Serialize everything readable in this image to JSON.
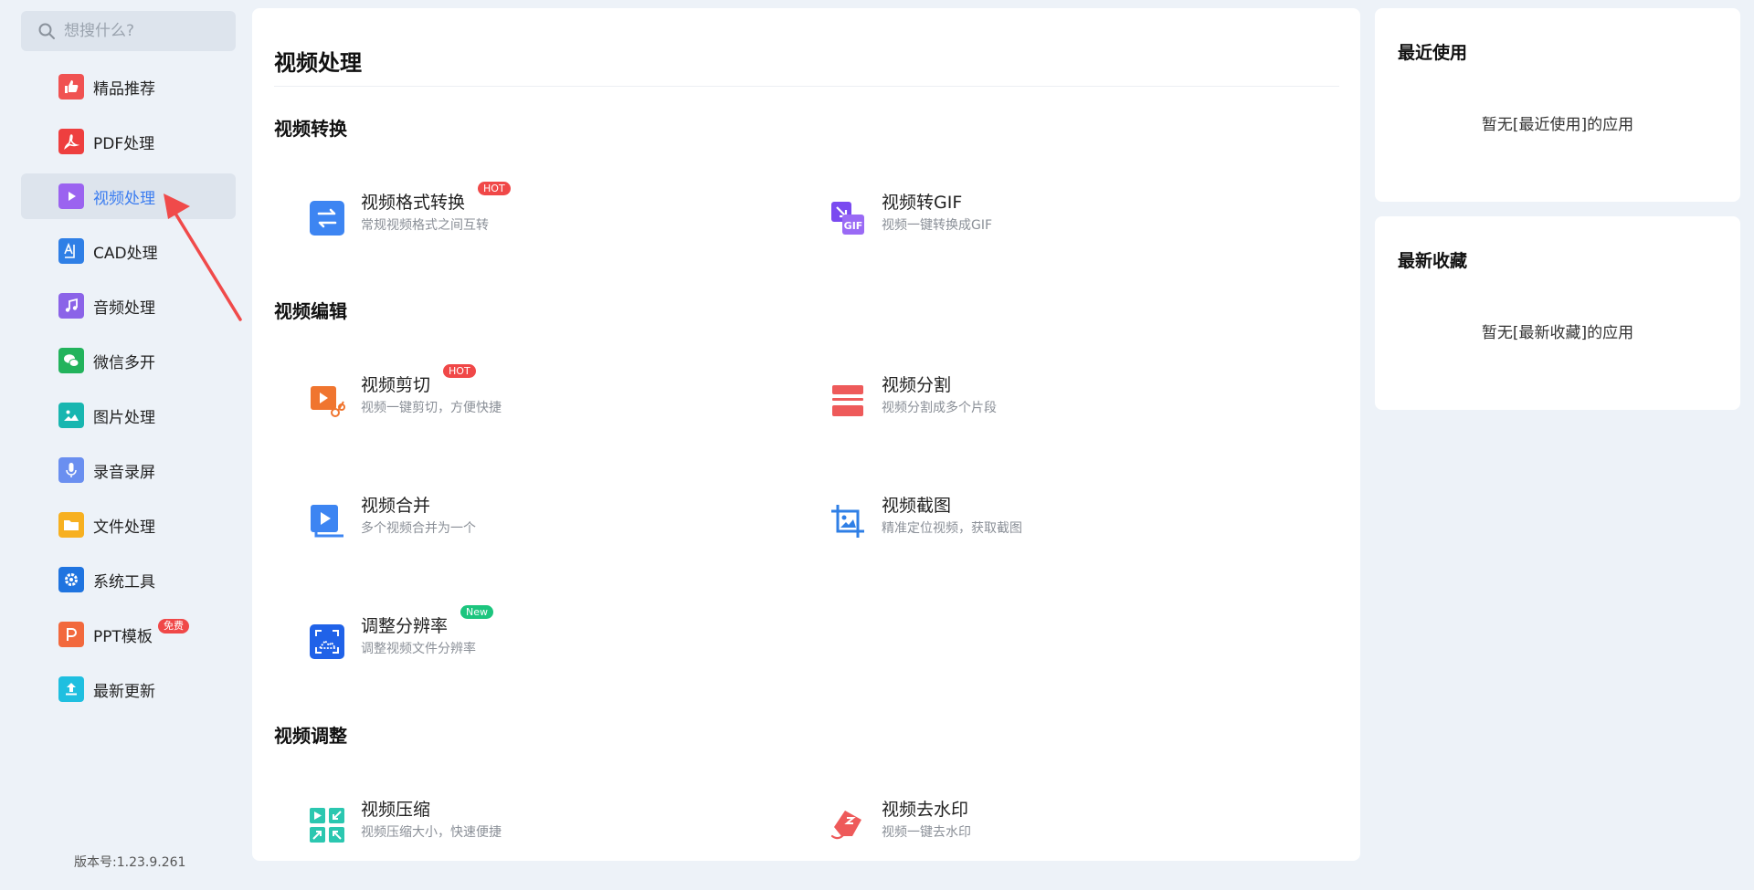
{
  "search": {
    "placeholder": "想搜什么?"
  },
  "sidebar": {
    "items": [
      {
        "label": "精品推荐",
        "icon": "thumbs-up-icon",
        "color": "#f05252"
      },
      {
        "label": "PDF处理",
        "icon": "pdf-icon",
        "color": "#ee3f3f"
      },
      {
        "label": "视频处理",
        "icon": "play-icon",
        "color": "#9b63f0",
        "active": true
      },
      {
        "label": "CAD处理",
        "icon": "cad-icon",
        "color": "#2f7fe6"
      },
      {
        "label": "音频处理",
        "icon": "music-note-icon",
        "color": "#8b63e8"
      },
      {
        "label": "微信多开",
        "icon": "wechat-icon",
        "color": "#22b35c"
      },
      {
        "label": "图片处理",
        "icon": "image-icon",
        "color": "#18b6b0"
      },
      {
        "label": "录音录屏",
        "icon": "microphone-icon",
        "color": "#6a8ff0"
      },
      {
        "label": "文件处理",
        "icon": "folder-icon",
        "color": "#f7b020"
      },
      {
        "label": "系统工具",
        "icon": "gear-icon",
        "color": "#1f74e0"
      },
      {
        "label": "PPT模板",
        "icon": "ppt-icon",
        "color": "#f2693d",
        "badge": "免费"
      },
      {
        "label": "最新更新",
        "icon": "upload-icon",
        "color": "#1fbfe0"
      }
    ],
    "version": "版本号:1.23.9.261"
  },
  "main": {
    "title": "视频处理",
    "sections": [
      {
        "title": "视频转换"
      },
      {
        "title": "视频编辑"
      },
      {
        "title": "视频调整"
      }
    ],
    "tools": [
      {
        "name": "视频格式转换",
        "desc": "常规视频格式之间互转",
        "badge": "HOT",
        "icon": "convert-arrows-icon"
      },
      {
        "name": "视频转GIF",
        "desc": "视频一键转换成GIF",
        "icon": "gif-icon"
      },
      {
        "name": "视频剪切",
        "desc": "视频一键剪切，方便快捷",
        "badge": "HOT",
        "icon": "video-cut-icon"
      },
      {
        "name": "视频分割",
        "desc": "视频分割成多个片段",
        "icon": "split-icon"
      },
      {
        "name": "视频合并",
        "desc": "多个视频合并为一个",
        "icon": "merge-icon"
      },
      {
        "name": "视频截图",
        "desc": "精准定位视频，获取截图",
        "icon": "crop-image-icon"
      },
      {
        "name": "调整分辨率",
        "desc": "调整视频文件分辨率",
        "badge": "New",
        "icon": "resolution-icon"
      },
      {
        "name": "视频压缩",
        "desc": "视频压缩大小，快速便捷",
        "icon": "compress-icon"
      },
      {
        "name": "视频去水印",
        "desc": "视频一键去水印",
        "icon": "eraser-icon"
      }
    ]
  },
  "panels": {
    "recent": {
      "title": "最近使用",
      "empty": "暂无[最近使用]的应用"
    },
    "favorites": {
      "title": "最新收藏",
      "empty": "暂无[最新收藏]的应用"
    }
  }
}
